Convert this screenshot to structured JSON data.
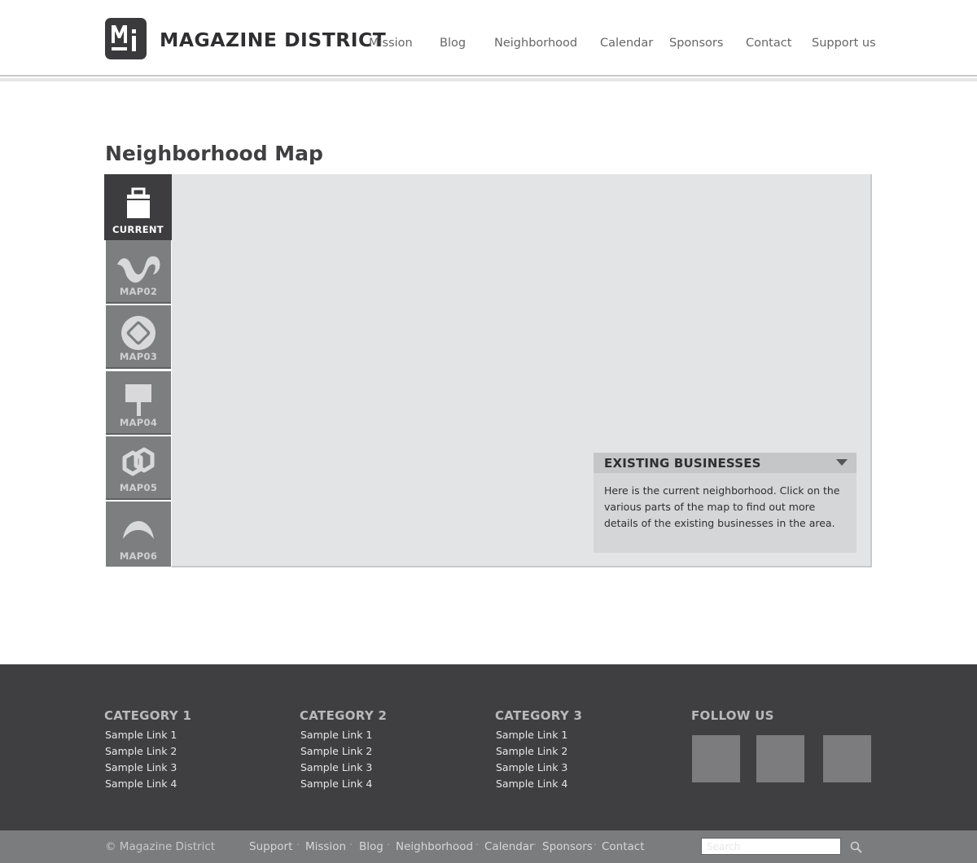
{
  "brand": {
    "name": "MAGAZINE DISTRICT",
    "logo_letters": "Mi"
  },
  "nav": {
    "items": [
      {
        "label": "Mission"
      },
      {
        "label": "Blog"
      },
      {
        "label": "Neighborhood"
      },
      {
        "label": "Calendar"
      },
      {
        "label": "Sponsors"
      },
      {
        "label": "Contact"
      },
      {
        "label": "Support us"
      }
    ]
  },
  "page": {
    "title": "Neighborhood Map"
  },
  "map": {
    "tabs": [
      {
        "label": "CURRENT",
        "icon": "briefcase-icon",
        "active": true
      },
      {
        "label": "MAP02",
        "icon": "wave-icon",
        "active": false
      },
      {
        "label": "MAP03",
        "icon": "diamond-circle-icon",
        "active": false
      },
      {
        "label": "MAP04",
        "icon": "signpost-icon",
        "active": false
      },
      {
        "label": "MAP05",
        "icon": "hexagon-link-icon",
        "active": false
      },
      {
        "label": "MAP06",
        "icon": "arch-icon",
        "active": false
      }
    ],
    "info": {
      "title": "EXISTING BUSINESSES",
      "body": "Here is the current neighborhood. Click on the various parts of the map to find out more details of the existing businesses in the area."
    }
  },
  "footer": {
    "columns": [
      {
        "heading": "CATEGORY 1",
        "links": [
          "Sample Link 1",
          "Sample Link 2",
          "Sample Link 3",
          "Sample Link 4"
        ]
      },
      {
        "heading": "CATEGORY 2",
        "links": [
          "Sample Link 1",
          "Sample Link 2",
          "Sample Link 3",
          "Sample Link 4"
        ]
      },
      {
        "heading": "CATEGORY 3",
        "links": [
          "Sample Link 1",
          "Sample Link 2",
          "Sample Link 3",
          "Sample Link 4"
        ]
      }
    ],
    "follow": {
      "heading": "FOLLOW US",
      "count": 3
    },
    "copyright": "© Magazine District",
    "bottom_links": [
      "Support",
      "Mission",
      "Blog",
      "Neighborhood",
      "Calendar",
      "Sponsors",
      "Contact"
    ],
    "separator": "·",
    "search_placeholder": "Search"
  },
  "colors": {
    "header_bg": "#ffffff",
    "dark": "#3f3f41",
    "tab_gray": "#7d7e80",
    "map_bg": "#e3e4e6"
  }
}
